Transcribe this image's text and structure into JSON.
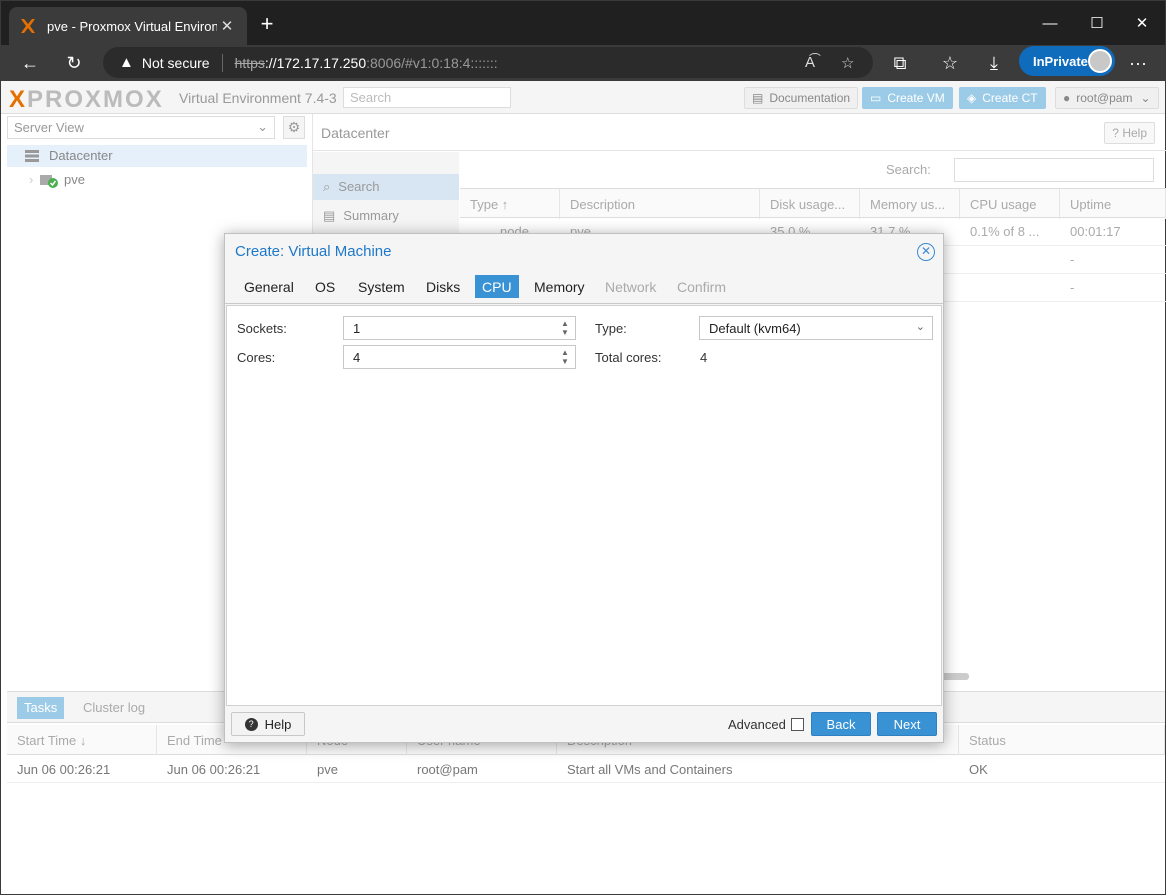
{
  "browser": {
    "tab_title": "pve - Proxmox Virtual Environme",
    "tab_close": "✕",
    "new_tab": "+",
    "minimize": "—",
    "maximize": "☐",
    "close": "✕",
    "not_secure": "Not secure",
    "url_scheme": "https",
    "url_host": "://172.17.17.250",
    "url_rest": ":8006/#v1:0:18:4:::::::",
    "inprivate": "InPrivate",
    "more": "···"
  },
  "header": {
    "logo_left": "X",
    "logo_text": "PROXMOX",
    "version": "Virtual Environment 7.4-3",
    "search_placeholder": "Search",
    "documentation": "Documentation",
    "create_vm": "Create VM",
    "create_ct": "Create CT",
    "user": "root@pam"
  },
  "tree": {
    "view": "Server View",
    "datacenter": "Datacenter",
    "node": "pve"
  },
  "datacenter": {
    "title": "Datacenter",
    "help": "Help",
    "menu": [
      "Search",
      "Summary"
    ],
    "search_label": "Search:",
    "columns": [
      "Type ↑",
      "Description",
      "Disk usage...",
      "Memory us...",
      "CPU usage",
      "Uptime"
    ],
    "rows": [
      {
        "type": "node",
        "description": "pve",
        "disk": "35.0 %",
        "memory": "31.7 %",
        "cpu": "0.1% of 8 ...",
        "uptime": "00:01:17"
      },
      {
        "uptime": "-"
      },
      {
        "uptime": "-"
      }
    ]
  },
  "tasks": {
    "tabs": [
      "Tasks",
      "Cluster log"
    ],
    "columns": [
      "Start Time ↓",
      "End Time",
      "Node",
      "User name",
      "Description",
      "Status"
    ],
    "rows": [
      {
        "start": "Jun 06 00:26:21",
        "end": "Jun 06 00:26:21",
        "node": "pve",
        "user": "root@pam",
        "description": "Start all VMs and Containers",
        "status": "OK"
      }
    ]
  },
  "dialog": {
    "title": "Create: Virtual Machine",
    "tabs": [
      "General",
      "OS",
      "System",
      "Disks",
      "CPU",
      "Memory",
      "Network",
      "Confirm"
    ],
    "active_tab": "CPU",
    "sockets_label": "Sockets:",
    "sockets_value": "1",
    "cores_label": "Cores:",
    "cores_value": "4",
    "type_label": "Type:",
    "type_value": "Default (kvm64)",
    "total_cores_label": "Total cores:",
    "total_cores_value": "4",
    "help": "Help",
    "advanced": "Advanced",
    "back": "Back",
    "next": "Next"
  },
  "colors": {
    "accent": "#3892d4",
    "title_blue": "#1e78c8",
    "proxmox_orange": "#e57000",
    "inprivate_blue": "#0f6cbd"
  }
}
